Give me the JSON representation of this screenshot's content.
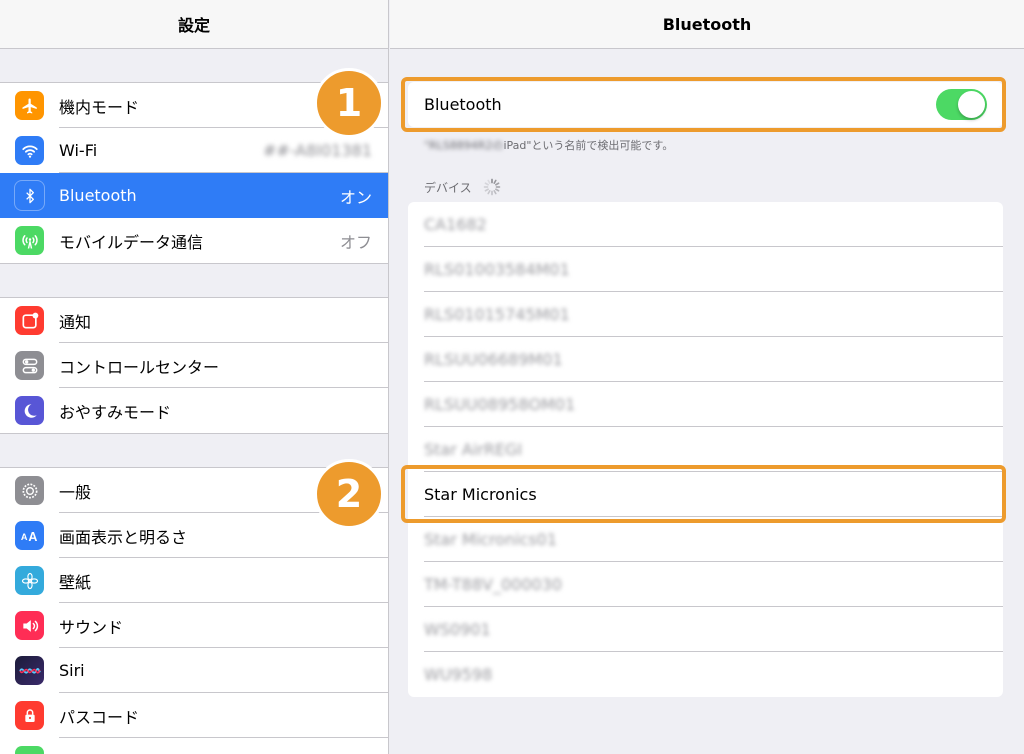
{
  "sidebar": {
    "title": "設定",
    "groups": [
      {
        "items": [
          {
            "label": "機内モード",
            "value": "",
            "icon": "airplane-icon",
            "color": "#ff9500"
          },
          {
            "label": "Wi-Fi",
            "value": "##-A8I01381",
            "icon": "wifi-icon",
            "color": "#2f7cf6"
          },
          {
            "label": "Bluetooth",
            "value": "オン",
            "icon": "bluetooth-icon",
            "color": "#2f7cf6"
          },
          {
            "label": "モバイルデータ通信",
            "value": "オフ",
            "icon": "cellular-icon",
            "color": "#4cd964"
          }
        ]
      },
      {
        "items": [
          {
            "label": "通知",
            "value": "",
            "icon": "notifications-icon",
            "color": "#ff3b30"
          },
          {
            "label": "コントロールセンター",
            "value": "",
            "icon": "control-center-icon",
            "color": "#8e8e93"
          },
          {
            "label": "おやすみモード",
            "value": "",
            "icon": "moon-icon",
            "color": "#5856d6"
          }
        ]
      },
      {
        "items": [
          {
            "label": "一般",
            "value": "",
            "icon": "gear-icon",
            "color": "#8e8e93"
          },
          {
            "label": "画面表示と明るさ",
            "value": "",
            "icon": "display-brightness-icon",
            "color": "#2f7cf6"
          },
          {
            "label": "壁紙",
            "value": "",
            "icon": "wallpaper-icon",
            "color": "#34aadc"
          },
          {
            "label": "サウンド",
            "value": "",
            "icon": "sound-icon",
            "color": "#ff2d55"
          },
          {
            "label": "Siri",
            "value": "",
            "icon": "siri-icon",
            "color": "#1c1c3a"
          },
          {
            "label": "パスコード",
            "value": "",
            "icon": "lock-icon",
            "color": "#ff3b30"
          }
        ]
      }
    ]
  },
  "detail": {
    "title": "Bluetooth",
    "bluetooth_label": "Bluetooth",
    "bluetooth_on": true,
    "discoverable_prefix": "\"RLS8894R2の",
    "discoverable_suffix": "iPad\"という名前で検出可能です。",
    "devices_header": "デバイス",
    "devices": [
      "CA1682",
      "RLS01003584M01",
      "RLS01015745M01",
      "RLSUU06689M01",
      "RLSUU08958OM01",
      "Star AirREGI",
      "Star Micronics",
      "Star Micronics01",
      "TM-T88V_000030",
      "WS0901",
      "WU9598"
    ]
  },
  "callouts": {
    "one": "1",
    "two": "2"
  },
  "colors": {
    "accent": "#ed9b2d",
    "selected_row": "#2f7cf6",
    "toggle_on": "#4cd964"
  }
}
